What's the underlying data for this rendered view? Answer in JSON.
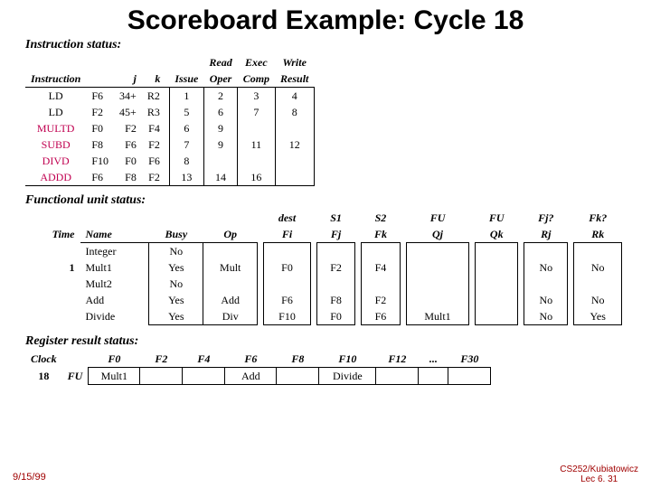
{
  "title": "Scoreboard Example: Cycle 18",
  "sections": {
    "instr": "Instruction status:",
    "fu": "Functional unit status:",
    "reg": "Register result status:"
  },
  "instr_headers": {
    "instr": "Instruction",
    "j": "j",
    "k": "k",
    "issue": "Issue",
    "read": "Read",
    "exec": "Exec",
    "write": "Write",
    "oper": "Oper",
    "comp": "Comp",
    "result": "Result"
  },
  "instr_rows": [
    {
      "op": "LD",
      "dest": "F6",
      "j": "34+",
      "k": "R2",
      "issue": "1",
      "read": "2",
      "exec": "3",
      "write": "4"
    },
    {
      "op": "LD",
      "dest": "F2",
      "j": "45+",
      "k": "R3",
      "issue": "5",
      "read": "6",
      "exec": "7",
      "write": "8"
    },
    {
      "op": "MULTD",
      "dest": "F0",
      "j": "F2",
      "k": "F4",
      "issue": "6",
      "read": "9",
      "exec": "",
      "write": ""
    },
    {
      "op": "SUBD",
      "dest": "F8",
      "j": "F6",
      "k": "F2",
      "issue": "7",
      "read": "9",
      "exec": "11",
      "write": "12"
    },
    {
      "op": "DIVD",
      "dest": "F10",
      "j": "F0",
      "k": "F6",
      "issue": "8",
      "read": "",
      "exec": "",
      "write": ""
    },
    {
      "op": "ADDD",
      "dest": "F6",
      "j": "F8",
      "k": "F2",
      "issue": "13",
      "read": "14",
      "exec": "16",
      "write": ""
    }
  ],
  "fu_headers": {
    "time": "Time",
    "name": "Name",
    "busy": "Busy",
    "op": "Op",
    "dest": "dest",
    "fi": "Fi",
    "s1": "S1",
    "fj": "Fj",
    "s2": "S2",
    "fk": "Fk",
    "fu1": "FU",
    "qj": "Qj",
    "fu2": "FU",
    "qk": "Qk",
    "fjq": "Fj?",
    "rj": "Rj",
    "fkq": "Fk?",
    "rk": "Rk"
  },
  "fu_rows": [
    {
      "time": "",
      "name": "Integer",
      "busy": "No",
      "op": "",
      "fi": "",
      "fj": "",
      "fk": "",
      "qj": "",
      "qk": "",
      "rj": "",
      "rk": ""
    },
    {
      "time": "1",
      "name": "Mult1",
      "busy": "Yes",
      "op": "Mult",
      "fi": "F0",
      "fj": "F2",
      "fk": "F4",
      "qj": "",
      "qk": "",
      "rj": "No",
      "rk": "No"
    },
    {
      "time": "",
      "name": "Mult2",
      "busy": "No",
      "op": "",
      "fi": "",
      "fj": "",
      "fk": "",
      "qj": "",
      "qk": "",
      "rj": "",
      "rk": ""
    },
    {
      "time": "",
      "name": "Add",
      "busy": "Yes",
      "op": "Add",
      "fi": "F6",
      "fj": "F8",
      "fk": "F2",
      "qj": "",
      "qk": "",
      "rj": "No",
      "rk": "No"
    },
    {
      "time": "",
      "name": "Divide",
      "busy": "Yes",
      "op": "Div",
      "fi": "F10",
      "fj": "F0",
      "fk": "F6",
      "qj": "Mult1",
      "qk": "",
      "rj": "No",
      "rk": "Yes"
    }
  ],
  "reg": {
    "clock_lbl": "Clock",
    "clock_val": "18",
    "fu_lbl": "FU",
    "regs": [
      "F0",
      "F2",
      "F4",
      "F6",
      "F8",
      "F10",
      "F12",
      "...",
      "F30"
    ],
    "vals": [
      "Mult1",
      "",
      "",
      "Add",
      "",
      "Divide",
      "",
      "",
      ""
    ]
  },
  "footer": {
    "date": "9/15/99",
    "course": "CS252/Kubiatowicz",
    "lec": "Lec 6. 31"
  }
}
